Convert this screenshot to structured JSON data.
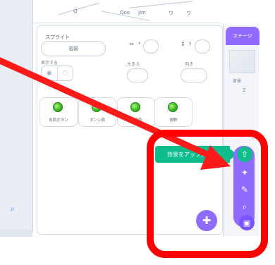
{
  "map": {
    "labels": [
      "Q",
      "Qoo",
      "Jim",
      "ワ",
      "ワ"
    ]
  },
  "sprite_panel": {
    "title": "スプライト",
    "name_field": "名前",
    "x_label": "x",
    "y_label": "y",
    "show_label": "表示する",
    "size_label": "大きさ",
    "direction_label": "向き"
  },
  "sprites": [
    {
      "name": "右肩ボタン"
    },
    {
      "name": "ダンシ肩"
    },
    {
      "name": "提供肩"
    },
    {
      "name": "視野"
    }
  ],
  "stage": {
    "title": "ステージ",
    "label": "背景",
    "count": "2"
  },
  "upload": {
    "label": "背景をアップロード"
  },
  "icons": {
    "upload": "upload-icon",
    "surprise": "sparkle-icon",
    "paint": "brush-icon",
    "search": "search-icon",
    "backdrop": "backdrop-icon",
    "sprite": "sprite-icon",
    "zoom": "zoom-icon"
  },
  "colors": {
    "accent": "#8f6bff",
    "upload": "#0fbd8c",
    "highlight": "#ff0000"
  }
}
